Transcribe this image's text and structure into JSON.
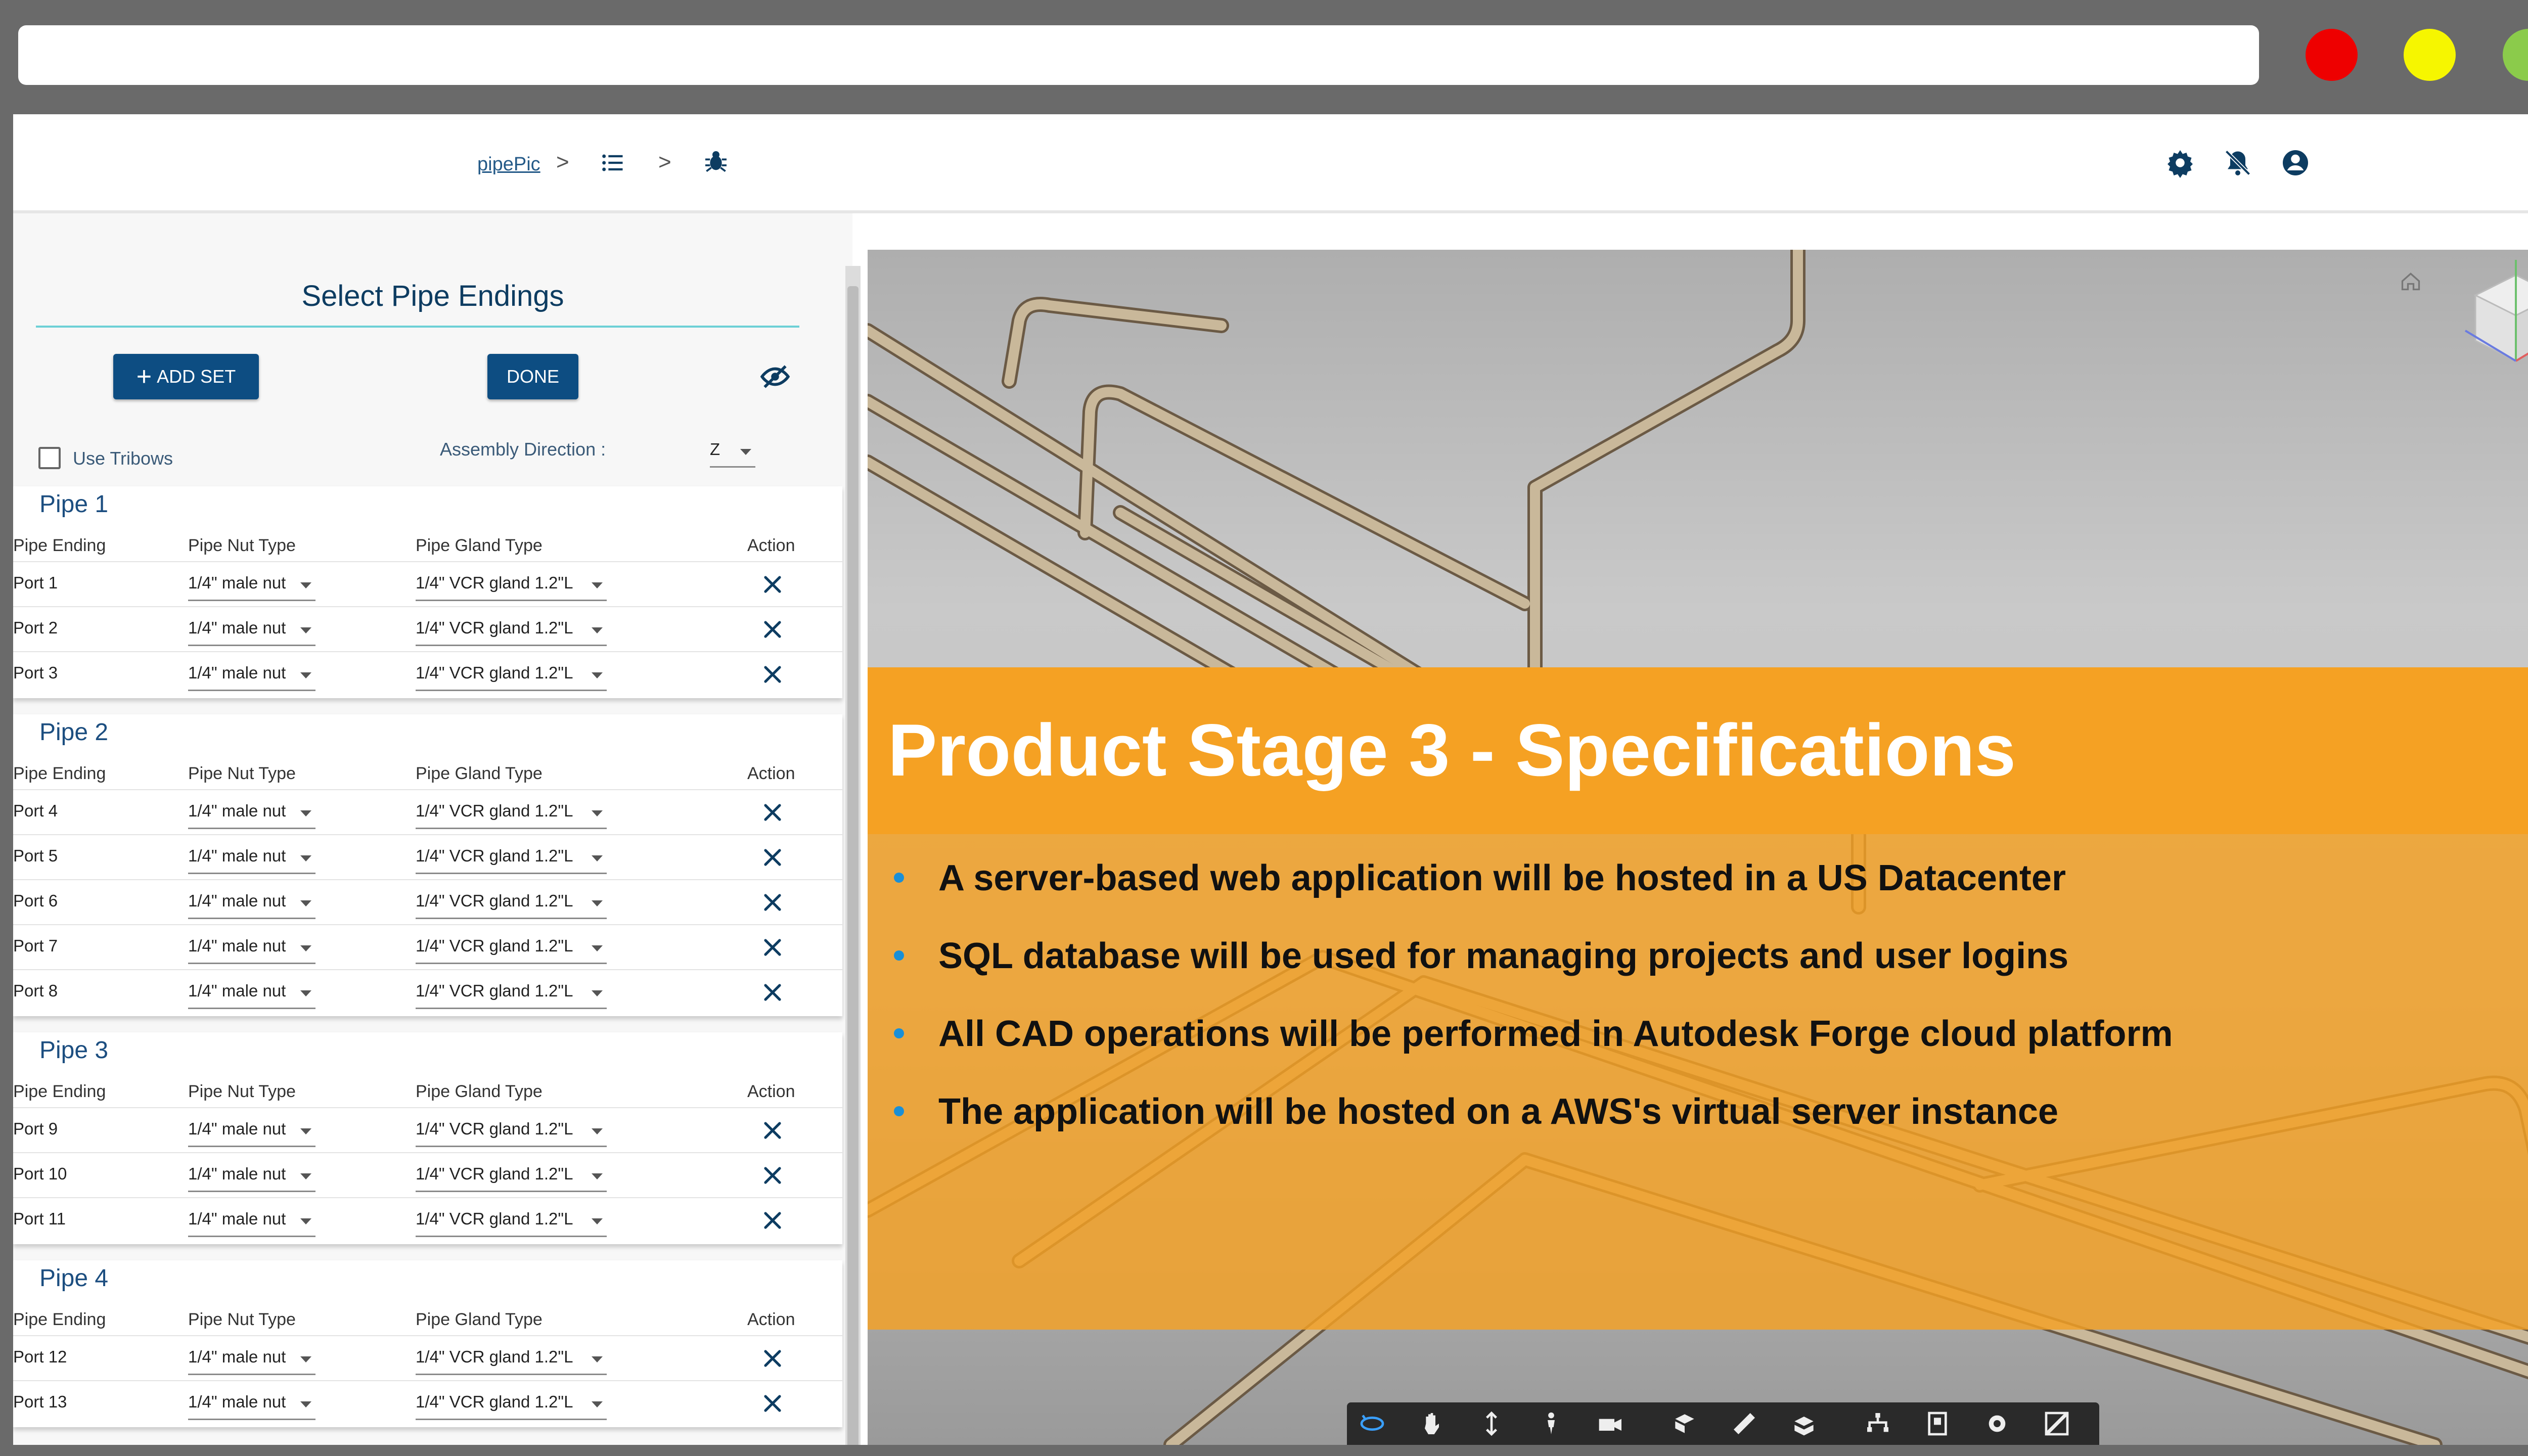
{
  "browser": {
    "url": "",
    "traffic_lights": [
      {
        "name": "close",
        "color": "#ee0000"
      },
      {
        "name": "minimize",
        "color": "#f6f600"
      },
      {
        "name": "maximize",
        "color": "#8bcb4b"
      }
    ]
  },
  "header": {
    "breadcrumb": {
      "root": "pipePic",
      "separator": ">",
      "icons": [
        "list-icon",
        "bug-icon"
      ]
    },
    "right_icons": [
      "gear-icon",
      "bell-off-icon",
      "account-icon"
    ]
  },
  "panel": {
    "title": "Select Pipe Endings",
    "add_set_label": "ADD SET",
    "done_label": "DONE",
    "visibility_icon": "eye-off-icon",
    "use_tribows_label": "Use Tribows",
    "use_tribows_checked": false,
    "assembly_direction_label": "Assembly Direction :",
    "assembly_direction_value": "Z",
    "columns": [
      "Pipe Ending",
      "Pipe Nut Type",
      "Pipe Gland Type",
      "Action"
    ],
    "pipes": [
      {
        "name": "Pipe 1",
        "ports": [
          {
            "port": "Port 1",
            "nut": "1/4\" male nut",
            "gland": "1/4\" VCR gland 1.2\"L"
          },
          {
            "port": "Port 2",
            "nut": "1/4\" male nut",
            "gland": "1/4\" VCR gland 1.2\"L"
          },
          {
            "port": "Port 3",
            "nut": "1/4\" male nut",
            "gland": "1/4\" VCR gland 1.2\"L"
          }
        ]
      },
      {
        "name": "Pipe 2",
        "ports": [
          {
            "port": "Port 4",
            "nut": "1/4\" male nut",
            "gland": "1/4\" VCR gland 1.2\"L"
          },
          {
            "port": "Port 5",
            "nut": "1/4\" male nut",
            "gland": "1/4\" VCR gland 1.2\"L"
          },
          {
            "port": "Port 6",
            "nut": "1/4\" male nut",
            "gland": "1/4\" VCR gland 1.2\"L"
          },
          {
            "port": "Port 7",
            "nut": "1/4\" male nut",
            "gland": "1/4\" VCR gland 1.2\"L"
          },
          {
            "port": "Port 8",
            "nut": "1/4\" male nut",
            "gland": "1/4\" VCR gland 1.2\"L"
          }
        ]
      },
      {
        "name": "Pipe 3",
        "ports": [
          {
            "port": "Port 9",
            "nut": "1/4\" male nut",
            "gland": "1/4\" VCR gland 1.2\"L"
          },
          {
            "port": "Port 10",
            "nut": "1/4\" male nut",
            "gland": "1/4\" VCR gland 1.2\"L"
          },
          {
            "port": "Port 11",
            "nut": "1/4\" male nut",
            "gland": "1/4\" VCR gland 1.2\"L"
          }
        ]
      },
      {
        "name": "Pipe 4",
        "ports": [
          {
            "port": "Port 12",
            "nut": "1/4\" male nut",
            "gland": "1/4\" VCR gland 1.2\"L"
          },
          {
            "port": "Port 13",
            "nut": "1/4\" male nut",
            "gland": "1/4\" VCR gland 1.2\"L"
          }
        ]
      }
    ]
  },
  "overlay": {
    "title": "Product Stage 3 - Specifications",
    "bullets": [
      "A server-based web application will be hosted in a US Datacenter",
      "SQL database will be used for managing projects and user logins",
      "All CAD operations will be performed in Autodesk Forge cloud platform",
      "The application will be hosted on a AWS's virtual server instance"
    ],
    "accent_color": "#f5a123"
  },
  "viewer": {
    "home_icon": "home-icon",
    "viewcube_icon": "viewcube-icon",
    "toolbar_icons": [
      "orbit-icon",
      "pan-icon",
      "zoom-icon",
      "first-person-icon",
      "camera-icon",
      "explode-icon",
      "measure-icon",
      "section-icon",
      "model-browser-icon",
      "properties-icon",
      "settings-icon",
      "fullscreen-icon"
    ]
  }
}
